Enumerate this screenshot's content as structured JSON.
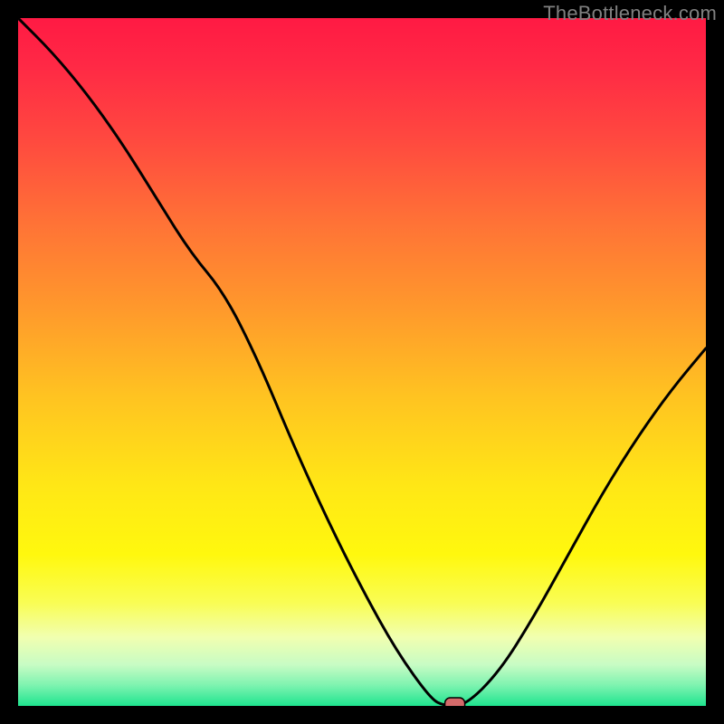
{
  "watermark": "TheBottleneck.com",
  "chart_data": {
    "type": "line",
    "title": "",
    "xlabel": "",
    "ylabel": "",
    "xlim": [
      0,
      100
    ],
    "ylim": [
      0,
      100
    ],
    "grid": false,
    "series": [
      {
        "name": "curve",
        "x": [
          0,
          5,
          10,
          15,
          20,
          25,
          30,
          35,
          40,
          45,
          50,
          55,
          60,
          62,
          65,
          70,
          75,
          80,
          85,
          90,
          95,
          100
        ],
        "y": [
          100,
          95,
          89,
          82,
          74,
          66,
          60,
          50,
          38,
          27,
          17,
          8,
          1,
          0,
          0,
          5,
          13,
          22,
          31,
          39,
          46,
          52
        ]
      }
    ],
    "marker": {
      "x": 63.5,
      "y": 0
    },
    "gradient_stops": [
      {
        "offset": 0.0,
        "color": "#ff1a44"
      },
      {
        "offset": 0.07,
        "color": "#ff2945"
      },
      {
        "offset": 0.18,
        "color": "#ff4a3f"
      },
      {
        "offset": 0.3,
        "color": "#ff7336"
      },
      {
        "offset": 0.42,
        "color": "#ff982c"
      },
      {
        "offset": 0.55,
        "color": "#ffc321"
      },
      {
        "offset": 0.68,
        "color": "#ffe716"
      },
      {
        "offset": 0.78,
        "color": "#fff80e"
      },
      {
        "offset": 0.85,
        "color": "#f9fd54"
      },
      {
        "offset": 0.9,
        "color": "#f1ffb0"
      },
      {
        "offset": 0.94,
        "color": "#c8fcc4"
      },
      {
        "offset": 0.97,
        "color": "#7ef3b0"
      },
      {
        "offset": 1.0,
        "color": "#1fe48f"
      }
    ]
  }
}
